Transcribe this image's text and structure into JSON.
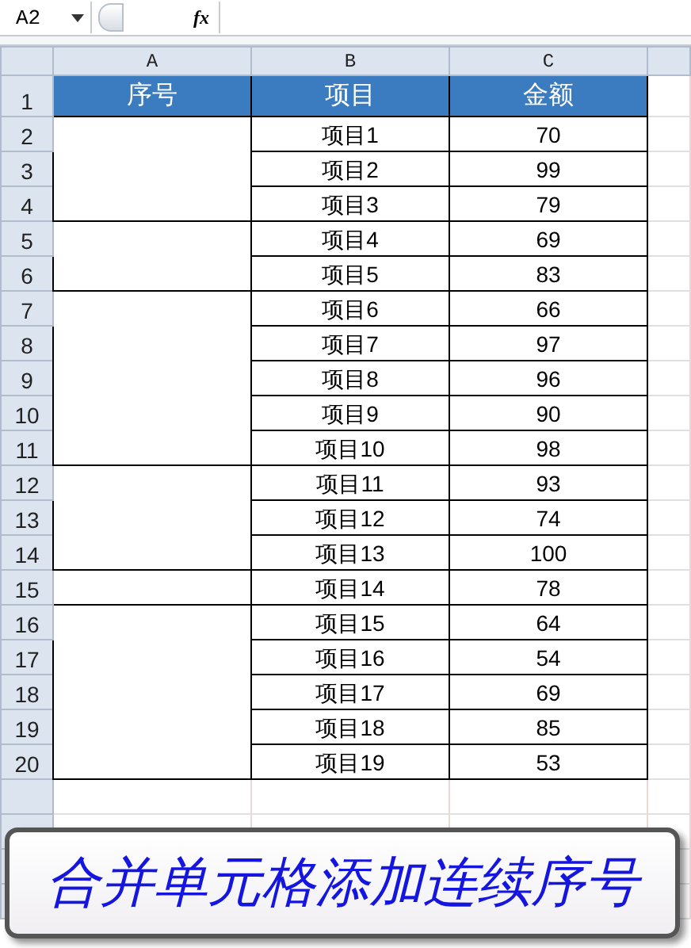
{
  "formula_bar": {
    "name_box": "A2",
    "fx": "fx"
  },
  "column_headers": [
    "A",
    "B",
    "C"
  ],
  "header_row": {
    "number": "1",
    "cells": [
      "序号",
      "项目",
      "金额"
    ]
  },
  "groups": [
    {
      "rows": [
        {
          "number": "2",
          "item": "项目1",
          "amount": "70"
        },
        {
          "number": "3",
          "item": "项目2",
          "amount": "99"
        },
        {
          "number": "4",
          "item": "项目3",
          "amount": "79"
        }
      ]
    },
    {
      "rows": [
        {
          "number": "5",
          "item": "项目4",
          "amount": "69"
        },
        {
          "number": "6",
          "item": "项目5",
          "amount": "83"
        }
      ]
    },
    {
      "rows": [
        {
          "number": "7",
          "item": "项目6",
          "amount": "66"
        },
        {
          "number": "8",
          "item": "项目7",
          "amount": "97"
        },
        {
          "number": "9",
          "item": "项目8",
          "amount": "96"
        },
        {
          "number": "10",
          "item": "项目9",
          "amount": "90"
        },
        {
          "number": "11",
          "item": "项目10",
          "amount": "98"
        }
      ]
    },
    {
      "rows": [
        {
          "number": "12",
          "item": "项目11",
          "amount": "93"
        },
        {
          "number": "13",
          "item": "项目12",
          "amount": "74"
        },
        {
          "number": "14",
          "item": "项目13",
          "amount": "100"
        }
      ]
    },
    {
      "rows": [
        {
          "number": "15",
          "item": "项目14",
          "amount": "78"
        }
      ]
    },
    {
      "rows": [
        {
          "number": "16",
          "item": "项目15",
          "amount": "64"
        },
        {
          "number": "17",
          "item": "项目16",
          "amount": "54"
        },
        {
          "number": "18",
          "item": "项目17",
          "amount": "69"
        },
        {
          "number": "19",
          "item": "项目18",
          "amount": "85"
        },
        {
          "number": "20",
          "item": "项目19",
          "amount": "53"
        }
      ]
    }
  ],
  "caption": "合并单元格添加连续序号"
}
